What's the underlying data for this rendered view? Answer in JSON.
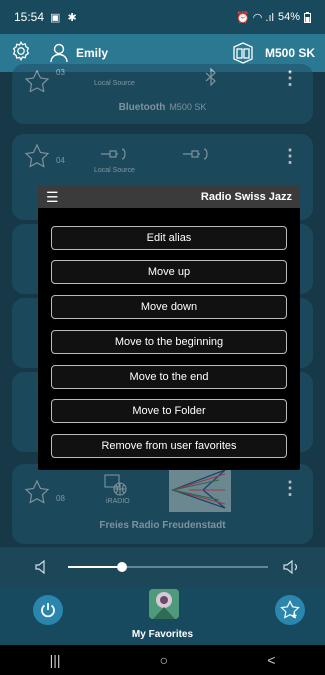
{
  "status": {
    "time": "15:54",
    "left_icons": "▣ ✱",
    "right_icons": "⏰ ◠ .ıl",
    "battery": "54%"
  },
  "appbar": {
    "settings_icon": "gear-icon",
    "user_name": "Emily",
    "device_name": "M500 SK"
  },
  "cards": {
    "card1": {
      "number": "03",
      "source": "Local Source",
      "title": "Bluetooth",
      "subtitle": "M500 SK"
    },
    "card2": {
      "number": "04",
      "source": "Local Source"
    },
    "card3": {
      "number": "08",
      "source": "iRADIO",
      "title": "Freies Radio Freudenstadt"
    }
  },
  "dialog": {
    "title": "Radio Swiss Jazz",
    "items": [
      "Edit alias",
      "Move up",
      "Move down",
      "Move to the beginning",
      "Move to the end",
      "Move to Folder",
      "Remove from user favorites"
    ]
  },
  "volume": {
    "level": 0.27
  },
  "bottom": {
    "label": "My Favorites"
  },
  "navbar": {
    "recents": "|||",
    "home": "○",
    "back": "<"
  }
}
